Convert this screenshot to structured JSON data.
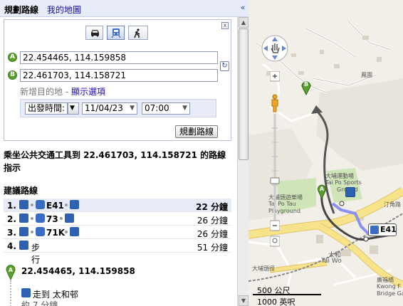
{
  "panel": {
    "title": "規劃路線",
    "my_maps": "我的地圖",
    "collapse_label": "«"
  },
  "form": {
    "travel_modes": [
      "car-icon",
      "transit-icon",
      "walk-icon"
    ],
    "selected_mode": "transit",
    "close_label": "x",
    "marker_a": "A",
    "marker_b": "B",
    "origin_value": "22.454465, 114.159858",
    "destination_value": "22.461703, 114.158721",
    "swap_label": "↻",
    "add_destination": "新增目的地",
    "separator": " - ",
    "show_options": "顯示選項",
    "depart_option": "出發時間:",
    "date_value": "11/04/23",
    "time_value": "07:00",
    "submit_label": "規劃路線"
  },
  "results": {
    "title": "乘坐公共交通工具到 22.461703, 114.158721 的路線指示",
    "suggested_heading": "建議路線",
    "routes": [
      {
        "num": "1.",
        "label": "E41",
        "time": "22 分鐘"
      },
      {
        "num": "2.",
        "label": "73",
        "time": "26 分鐘"
      },
      {
        "num": "3.",
        "label": "71K",
        "time": "26 分鐘"
      },
      {
        "num": "4.",
        "label": "步行",
        "time": "51 分鐘"
      }
    ],
    "start_marker": "A",
    "start_coords": "22.454465, 114.159858",
    "step1_text": "走到 太和邨",
    "step1_sub": "約 7 分鐘"
  },
  "map": {
    "marker_a": "A",
    "marker_b": "B",
    "bus_route": "E41",
    "label_playground_zh": "大埔頭遊樂場",
    "label_playground_en": "Tai Po Tau",
    "label_playground_en2": "Playground",
    "label_sports_zh": "大埔運動場",
    "label_sports_en": "Tai Po Sports",
    "label_sports_en2": "Ground",
    "label_taiwo_zh": "太和",
    "label_taiwo_en": "Tai Wo",
    "label_kwong_zh": "廣福橋",
    "label_kwong_en": "Kwong F",
    "label_kwong_en2": "Bridge Ga",
    "label_village": "鳳園",
    "label_road1": "汀角路",
    "label_road2": "大埔頭徑",
    "scale_metric": "500 公尺",
    "scale_imperial": "1000 英呎"
  },
  "colors": {
    "marker_green": "#5aa02c",
    "route_line": "#555555",
    "walk_path": "#8a8ff0",
    "road_yellow": "#f7e48a",
    "panel_blue": "#e8ecf9",
    "link": "#1a0dab"
  }
}
